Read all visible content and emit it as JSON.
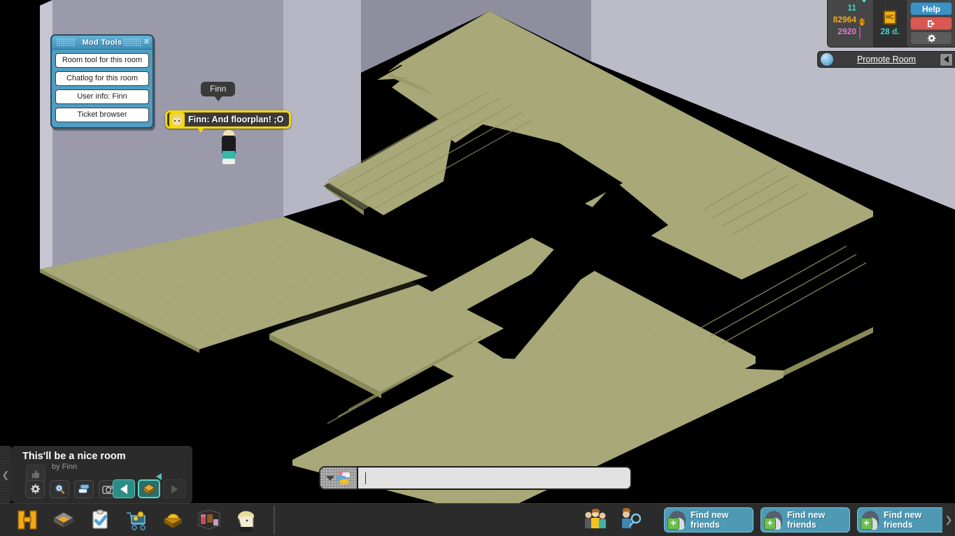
{
  "room": {
    "floor_color": "#a8a878",
    "floor_shade_color": "#8f8f60",
    "wall_left_color": "#8e8e9e",
    "wall_right_color": "#bcbcc8",
    "background_color": "#000000"
  },
  "mod_tools": {
    "title": "Mod Tools",
    "close_icon": "close-icon",
    "buttons": [
      "Room tool for this room",
      "Chatlog for this room",
      "User info: Finn",
      "Ticket browser"
    ]
  },
  "avatar": {
    "nametag": "Finn",
    "chat_message": "Finn: And floorplan! ;O",
    "bubble_border_color": "#f5d800"
  },
  "hud": {
    "currencies": [
      {
        "value": "11",
        "icon": "diamond-icon",
        "color": "#41d4c8"
      },
      {
        "value": "82964",
        "icon": "credit-icon",
        "color": "#f2a813"
      },
      {
        "value": "2920",
        "icon": "ducket-icon",
        "color": "#e07ad4"
      }
    ],
    "hc": {
      "badge_text": "HC",
      "days": "28 d."
    },
    "buttons": {
      "help": "Help",
      "logout_icon": "logout-icon",
      "settings_icon": "gear-icon"
    }
  },
  "promote": {
    "label": "Promote Room",
    "icon": "promote-globe-icon",
    "collapse_icon": "chevron-left-icon"
  },
  "room_info": {
    "title": "This'll be a nice room",
    "owner": "by Finn",
    "like_icon": "thumbs-up-icon",
    "buttons": [
      {
        "name": "room-settings-button",
        "icon": "gear-icon"
      },
      {
        "name": "zoom-button",
        "icon": "magnifier-icon"
      },
      {
        "name": "chat-history-button",
        "icon": "chat-history-icon"
      },
      {
        "name": "camera-button",
        "icon": "camera-icon"
      }
    ],
    "nav": [
      {
        "name": "prev-room-button",
        "icon": "arrow-left-icon",
        "state": "teal"
      },
      {
        "name": "room-home-button",
        "icon": "room-cube-icon",
        "state": "active"
      },
      {
        "name": "next-room-button",
        "icon": "arrow-right-icon",
        "state": "disabled"
      }
    ]
  },
  "chat_input": {
    "value": "",
    "placeholder": "",
    "style_icon": "chat-style-icon",
    "dropdown_icon": "chevron-down-icon"
  },
  "toolbar": {
    "items": [
      {
        "name": "habbo-logo-button",
        "icon": "habbo-h-icon"
      },
      {
        "name": "navigator-button",
        "icon": "navigator-icon"
      },
      {
        "name": "quests-button",
        "icon": "clipboard-check-icon"
      },
      {
        "name": "catalog-button",
        "icon": "shopping-cart-icon"
      },
      {
        "name": "builders-club-button",
        "icon": "hard-hat-icon"
      },
      {
        "name": "inventory-button",
        "icon": "furniture-room-icon"
      },
      {
        "name": "avatar-button",
        "icon": "avatar-head-icon"
      }
    ],
    "friends_icons": [
      {
        "name": "friends-group-icon",
        "icon": "friends-group-icon"
      },
      {
        "name": "friend-search-icon",
        "icon": "friend-search-icon"
      }
    ],
    "friend_buttons": [
      {
        "label_line1": "Find new",
        "label_line2": "friends"
      },
      {
        "label_line1": "Find new",
        "label_line2": "friends"
      },
      {
        "label_line1": "Find new",
        "label_line2": "friends"
      }
    ],
    "collapse_left_icon": "chevron-left-icon",
    "collapse_right_icon": "chevron-right-icon"
  }
}
